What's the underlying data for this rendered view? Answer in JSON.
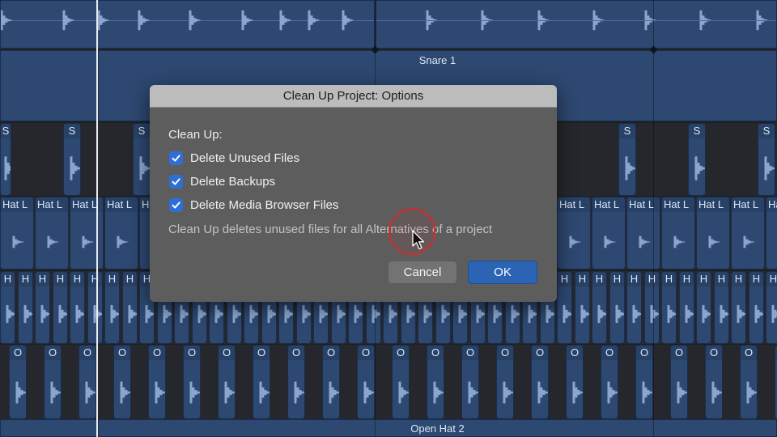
{
  "tracks": {
    "snare_region_label": "Snare 1",
    "open_hat_region_label": "Open Hat 2",
    "sample_region_label": "S",
    "hat_loop_label": "Hat L",
    "hat_label": "H",
    "open_hat_label": "O"
  },
  "dialog": {
    "title": "Clean Up Project: Options",
    "section_label": "Clean Up:",
    "options": [
      {
        "label": "Delete Unused Files",
        "checked": true
      },
      {
        "label": "Delete Backups",
        "checked": true
      },
      {
        "label": "Delete Media Browser Files",
        "checked": true
      }
    ],
    "note": "Clean Up deletes unused files for all Alternatives of a project",
    "cancel_label": "Cancel",
    "ok_label": "OK"
  },
  "colors": {
    "region": "#2d4871",
    "accent": "#2b63b5",
    "click_highlight": "#d52b2b"
  }
}
